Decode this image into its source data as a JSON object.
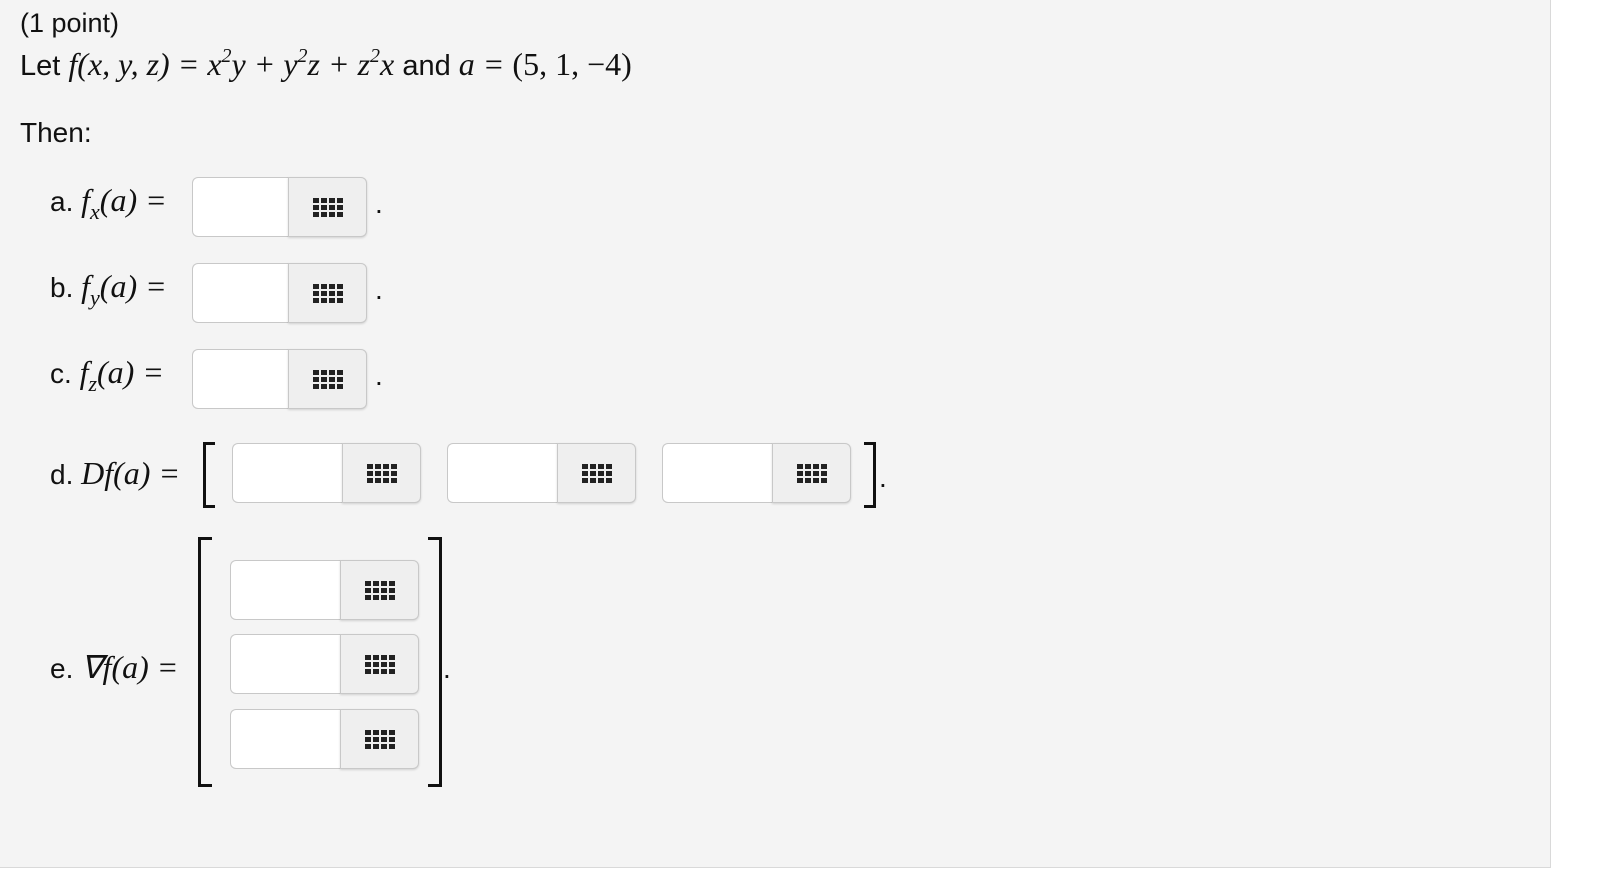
{
  "problem": {
    "points": "(1 point)",
    "let_word": "Let",
    "function_lhs": "f(x, y, z) =",
    "and_word": "and",
    "point_lhs": "a =",
    "point_value": "(5, 1, −4)",
    "then": "Then:"
  },
  "parts": {
    "a": {
      "label": "a.",
      "func": "f",
      "sub": "x",
      "arg": "(a) =",
      "period": "."
    },
    "b": {
      "label": "b.",
      "func": "f",
      "sub": "y",
      "arg": "(a) =",
      "period": "."
    },
    "c": {
      "label": "c.",
      "func": "f",
      "sub": "z",
      "arg": "(a) =",
      "period": "."
    },
    "d": {
      "label": "d.",
      "expr": "Df(a) =",
      "period": "."
    },
    "e": {
      "label": "e.",
      "expr": "∇f(a) =",
      "period": "."
    }
  },
  "inputs": {
    "a": "",
    "b": "",
    "c": "",
    "d1": "",
    "d2": "",
    "d3": "",
    "e1": "",
    "e2": "",
    "e3": ""
  },
  "icons": {
    "equation_editor": "grid-icon"
  }
}
